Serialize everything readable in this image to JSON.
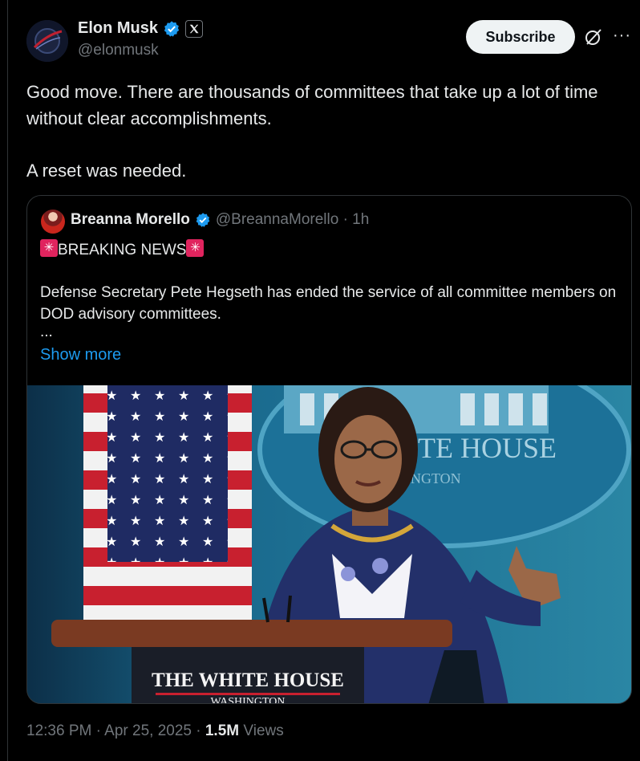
{
  "author": {
    "name": "Elon Musk",
    "handle": "@elonmusk"
  },
  "header": {
    "subscribe_label": "Subscribe",
    "more_glyph": "···"
  },
  "post": {
    "paragraph_1": "Good move. There are thousands of committees that take up a lot of time without clear accomplishments.",
    "paragraph_2": "A reset was needed."
  },
  "quoted": {
    "name": "Breanna Morello",
    "handle_time": "@BreannaMorello · 1h",
    "headline": "BREAKING NEWS",
    "body": "Defense Secretary Pete Hegseth has ended the service of all committee members on DOD advisory committees.",
    "ellipsis": "...",
    "show_more": "Show more",
    "media": {
      "backdrop_text": "ITE HOUSE",
      "backdrop_subtext": "NGTON",
      "podium_text": "THE WHITE HOUSE",
      "podium_subtext": "WASHINGTON"
    }
  },
  "meta": {
    "time_date": "12:36 PM · Apr 25, 2025 · ",
    "views_count": "1.5M",
    "views_label": " Views"
  },
  "colors": {
    "background": "#000000",
    "text": "#e7e9ea",
    "muted": "#71767b",
    "link": "#1d9bf0",
    "verified": "#1d9bf0",
    "border": "#2f3336"
  },
  "icons": [
    "verified-badge-icon",
    "x-logo-icon",
    "grok-icon",
    "more-icon",
    "siren-icon"
  ]
}
